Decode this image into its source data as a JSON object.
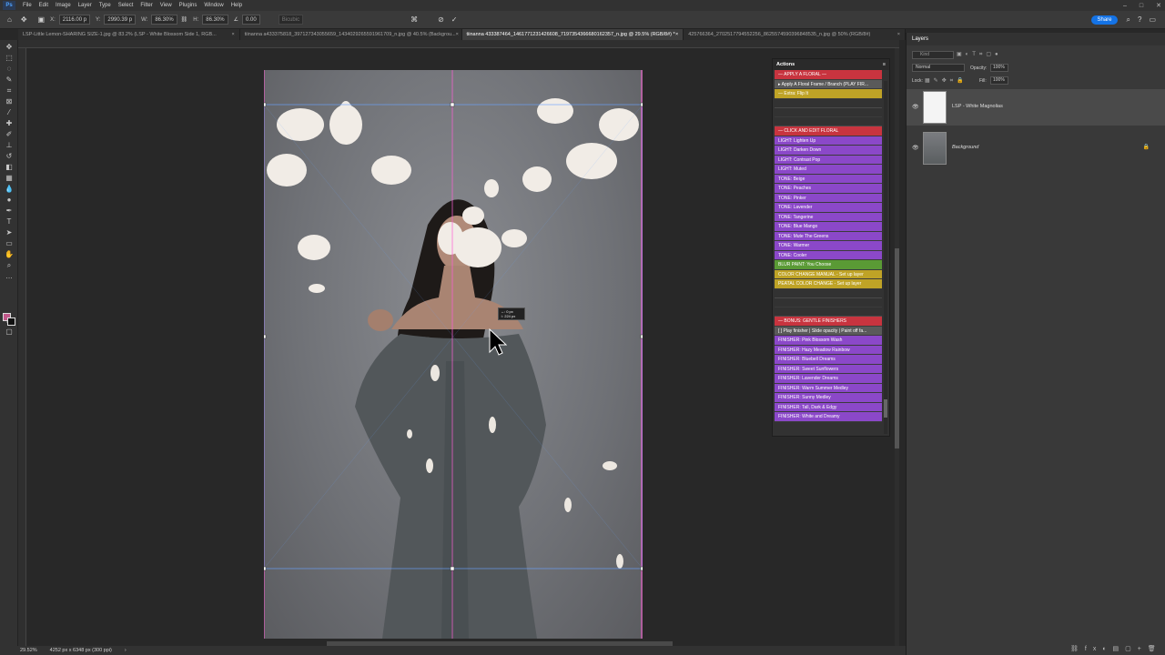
{
  "menu": [
    "File",
    "Edit",
    "Image",
    "Layer",
    "Type",
    "Select",
    "Filter",
    "View",
    "Plugins",
    "Window",
    "Help"
  ],
  "window_controls": [
    "–",
    "□",
    "✕"
  ],
  "options": {
    "x_label": "X:",
    "x_value": "2116.00 p",
    "y_label": "Y:",
    "y_value": "2990.39 p",
    "w_label": "W:",
    "w_value": "86.30%",
    "h_label": "H:",
    "h_value": "86.30%",
    "angle_value": "0.00",
    "interp": "Bicubic",
    "share": "Share"
  },
  "tabs": [
    {
      "label": "LSP-Little Lemon-SHARING SIZE-1.jpg @ 83.2% (LSP - White Blossom Side 1, RGB...",
      "close": "×",
      "active": false
    },
    {
      "label": "tiinanna a433375818_397127343055659_1434029265591961709_n.jpg @ 40.5% (Backgrou...",
      "close": "×",
      "active": false
    },
    {
      "label": "tiinanna 433387464_1461771231426608_7197354366680162357_n.jpg @ 29.5% (RGB/8#) *",
      "close": "×",
      "active": true
    },
    {
      "label": "425766364_2702517794552256_8625574590396848535_n.jpg @ 50% (RGB/8#)",
      "close": "×",
      "active": false
    }
  ],
  "transform_tooltip": {
    "line1": "↔: 0 px",
    "line2": "↕: 224 px"
  },
  "statusbar": {
    "zoom": "29.52%",
    "doc": "4252 px x 6348 px (300 ppi)",
    "chev": "›"
  },
  "actions": {
    "title": "Actions",
    "items": [
      {
        "label": "— APPLY A FLORAL —",
        "color": "red"
      },
      {
        "label": "▸ Apply A Floral Frame / Branch (PLAY FIR...",
        "color": "gray"
      },
      {
        "label": "— Extra: Flip It",
        "color": "yellow"
      },
      {
        "label": "",
        "color": "sep"
      },
      {
        "label": "",
        "color": "blank"
      },
      {
        "label": "",
        "color": "sep"
      },
      {
        "label": "— CLICK AND EDIT FLORAL",
        "color": "red"
      },
      {
        "label": "LIGHT: Lighten Up",
        "color": "purple"
      },
      {
        "label": "LIGHT: Darken Down",
        "color": "purple"
      },
      {
        "label": "LIGHT: Contrast Pop",
        "color": "purple"
      },
      {
        "label": "LIGHT: Muted",
        "color": "purple"
      },
      {
        "label": "TONE: Beige",
        "color": "purple"
      },
      {
        "label": "TONE: Peaches",
        "color": "purple"
      },
      {
        "label": "TONE: Pinker",
        "color": "purple"
      },
      {
        "label": "TONE: Lavender",
        "color": "purple"
      },
      {
        "label": "TONE: Tangerine",
        "color": "purple"
      },
      {
        "label": "TONE: Blue Mango",
        "color": "purple"
      },
      {
        "label": "TONE: Mute The Greens",
        "color": "purple"
      },
      {
        "label": "TONE: Warmer",
        "color": "purple"
      },
      {
        "label": "TONE: Cooler",
        "color": "purple"
      },
      {
        "label": "BLUR PAINT: You Choose",
        "color": "green"
      },
      {
        "label": "COLOR CHANGE MANUAL - Set up layer",
        "color": "yellow"
      },
      {
        "label": "PEATAL COLOR CHANGE - Set up layer",
        "color": "yellow"
      },
      {
        "label": "",
        "color": "sep"
      },
      {
        "label": "",
        "color": "blank"
      },
      {
        "label": "",
        "color": "sep"
      },
      {
        "label": "— BONUS: GENTLE FINISHERS",
        "color": "red"
      },
      {
        "label": "[ ] Play finisher | Slide opacity | Paint off fa...",
        "color": "gray"
      },
      {
        "label": "FINISHER: Pink Blossom Wash",
        "color": "purple"
      },
      {
        "label": "FINISHER: Hazy Meadow Rainbow",
        "color": "purple"
      },
      {
        "label": "FINISHER: Bluebell Dreams",
        "color": "purple"
      },
      {
        "label": "FINISHER: Sweet Sunflowers",
        "color": "purple"
      },
      {
        "label": "FINISHER: Lavender Dreams",
        "color": "purple"
      },
      {
        "label": "FINISHER: Warm Summer Medley",
        "color": "purple"
      },
      {
        "label": "FINISHER: Sunny Medley",
        "color": "purple"
      },
      {
        "label": "FINISHER: Tall, Dark & Edgy",
        "color": "purple"
      },
      {
        "label": "FINISHER: White and Dreamy",
        "color": "purple"
      }
    ]
  },
  "layers": {
    "title": "Layers",
    "search_placeholder": "Kind",
    "blend_mode": "Normal",
    "opacity_label": "Opacity:",
    "opacity_value": "100%",
    "lock_label": "Lock:",
    "fill_label": "Fill:",
    "fill_value": "100%",
    "items": [
      {
        "name": "LSP - White Magnolias",
        "selected": true
      },
      {
        "name": "Background",
        "selected": false
      }
    ]
  }
}
